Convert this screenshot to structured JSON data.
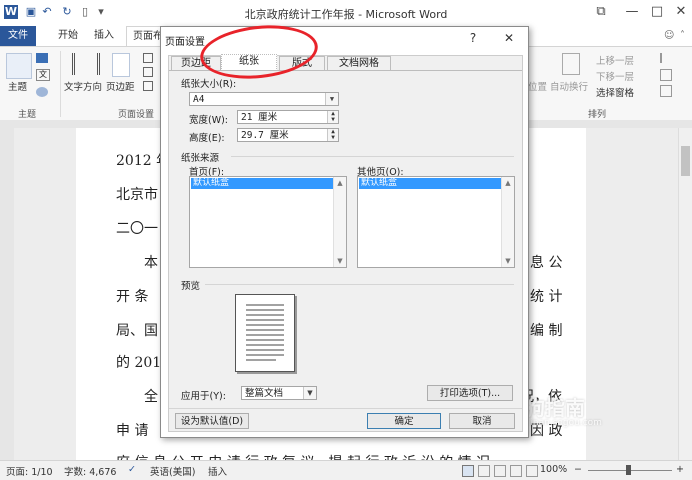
{
  "window": {
    "title": "北京政府统计工作年报 - Microsoft Word",
    "app_icon": "W",
    "controls": {
      "help": "?",
      "restore": "⧉",
      "minimize": "—",
      "maximize": "□",
      "close": "✕"
    }
  },
  "ribbon": {
    "tabs": [
      "文件",
      "开始",
      "插入",
      "页面布"
    ],
    "groups": {
      "theme": {
        "button": "主题",
        "label": "主题"
      },
      "page_setup": {
        "text_direction": "文字方向",
        "margins": "页边距",
        "label": "页面设置"
      },
      "arrange": {
        "position": "位置",
        "wrap_text": "自动换行",
        "bring_forward": "上移一层",
        "send_backward": "下移一层",
        "selection_pane": "选择窗格",
        "label": "排列"
      }
    }
  },
  "document": {
    "lines": [
      "2012 年",
      "北京市",
      "二〇一",
      "本",
      "开 条",
      "局、国",
      "的 201",
      "全",
      "申 请",
      "府 信 息 公 开 申 请 行 政 复 议，提 起 行 政 诉 讼 的 情 况"
    ],
    "right_fragments": [
      "息 公",
      "统 计",
      "编 制",
      "况，依",
      "因 政"
    ]
  },
  "dialog": {
    "title": "页面设置",
    "tabs": [
      "页边距",
      "纸张",
      "版式",
      "文档网格"
    ],
    "active_tab": "纸张",
    "paper_size": {
      "section": "纸张大小(R):",
      "value": "A4",
      "width_label": "宽度(W):",
      "width_value": "21 厘米",
      "height_label": "高度(E):",
      "height_value": "29.7 厘米"
    },
    "paper_source": {
      "section": "纸张来源",
      "first_page_label": "首页(F):",
      "first_page_selected": "默认纸盒",
      "other_pages_label": "其他页(O):",
      "other_pages_selected": "默认纸盒"
    },
    "preview": {
      "section": "预览"
    },
    "apply_to": {
      "label": "应用于(Y):",
      "value": "整篇文档"
    },
    "print_options": "打印选项(T)...",
    "set_default": "设为默认值(D)",
    "ok": "确定",
    "cancel": "取消"
  },
  "status_bar": {
    "page": "页面: 1/10",
    "words": "字数: 4,676",
    "language": "英语(美国)",
    "mode": "插入",
    "zoom": "100%"
  },
  "watermark": {
    "text": "搜狗指南",
    "sub": "zhinan.sogou.com"
  },
  "colors": {
    "accent": "#2b579a",
    "highlight": "#3399ff",
    "annotation": "#e8232a"
  }
}
